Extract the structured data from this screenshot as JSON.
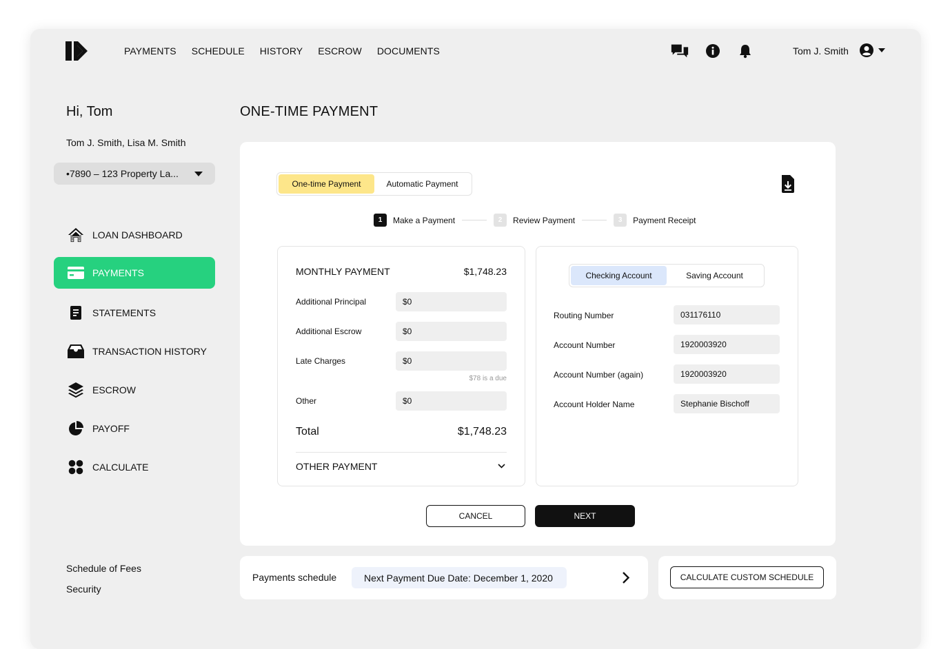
{
  "nav": {
    "items": [
      "PAYMENTS",
      "SCHEDULE",
      "HISTORY",
      "ESCROW",
      "DOCUMENTS"
    ],
    "user_name": "Tom J. Smith"
  },
  "sidebar": {
    "greeting": "Hi, Tom",
    "borrowers": "Tom J. Smith, Lisa M. Smith",
    "loan_selected": "•7890 – 123 Property La...",
    "items": [
      {
        "label": "LOAN DASHBOARD",
        "icon": "home-icon"
      },
      {
        "label": "PAYMENTS",
        "icon": "credit-card-icon"
      },
      {
        "label": "STATEMENTS",
        "icon": "document-icon"
      },
      {
        "label": "TRANSACTION HISTORY",
        "icon": "inbox-icon"
      },
      {
        "label": "ESCROW",
        "icon": "layers-icon"
      },
      {
        "label": "PAYOFF",
        "icon": "pie-chart-icon"
      },
      {
        "label": "CALCULATE",
        "icon": "grid-dots-icon"
      }
    ],
    "active": "PAYMENTS",
    "footer_links": [
      "Schedule of Fees",
      "Security"
    ]
  },
  "main": {
    "title": "ONE-TIME PAYMENT",
    "payment_tabs": [
      "One-time Payment",
      "Automatic Payment"
    ],
    "steps": [
      {
        "num": "1",
        "label": "Make a Payment"
      },
      {
        "num": "2",
        "label": "Review Payment"
      },
      {
        "num": "3",
        "label": "Payment Receipt"
      }
    ],
    "left_panel": {
      "monthly_label": "MONTHLY PAYMENT",
      "monthly_value": "$1,748.23",
      "rows": [
        {
          "label": "Additional Principal",
          "value": "$0"
        },
        {
          "label": "Additional Escrow",
          "value": "$0"
        },
        {
          "label": "Late Charges",
          "value": "$0"
        },
        {
          "label": "Other",
          "value": "$0"
        }
      ],
      "late_note": "$78 is a due",
      "total_label": "Total",
      "total_value": "$1,748.23",
      "other_payment_label": "OTHER PAYMENT"
    },
    "right_panel": {
      "account_tabs": [
        "Checking Account",
        "Saving Account"
      ],
      "rows": [
        {
          "label": "Routing Number",
          "value": "031176110"
        },
        {
          "label": "Account Number",
          "value": "1920003920"
        },
        {
          "label": "Account Number (again)",
          "value": "1920003920"
        },
        {
          "label": "Account Holder Name",
          "value": "Stephanie Bischoff"
        }
      ]
    },
    "cancel_label": "CANCEL",
    "next_label": "NEXT"
  },
  "schedule": {
    "label": "Payments schedule",
    "next_due": "Next Payment Due Date: December 1, 2020",
    "custom_button": "CALCULATE CUSTOM SCHEDULE"
  },
  "colors": {
    "accent_green": "#26d17f",
    "tab_yellow": "#fde68a",
    "tab_blue": "#dbe7fb",
    "due_chip": "#eef2fb"
  }
}
